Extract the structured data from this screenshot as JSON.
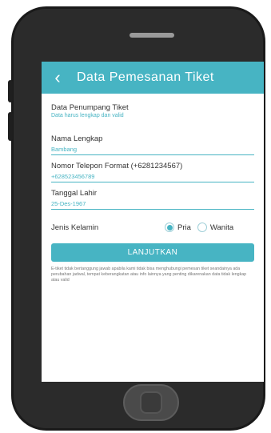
{
  "appbar": {
    "back_icon": "‹",
    "title": "Data Pemesanan Tiket"
  },
  "section": {
    "title": "Data Penumpang Tiket",
    "subtitle": "Data harus lengkap dan valid"
  },
  "fields": {
    "name": {
      "label": "Nama Lengkap",
      "value": "Bambang"
    },
    "phone": {
      "label": "Nomor Telepon Format (+6281234567)",
      "value": "+628523456789"
    },
    "dob": {
      "label": "Tanggal Lahir",
      "value": "25-Des-1967"
    }
  },
  "gender": {
    "label": "Jenis Kelamin",
    "options": [
      "Pria",
      "Wanita"
    ],
    "selected": "Pria"
  },
  "button": {
    "label": "LANJUTKAN"
  },
  "disclaimer": "E-tiket tidak bertanggung jawab apabila kami tidak bisa menghubungi pemesan tiket seandainya ada perubahan jadwal, tempat keberangkatan atau info lainnya yang penting dikarenakan data tidak lengkap atau valid",
  "colors": {
    "accent": "#47b4c3",
    "phone_body": "#2b2b2b"
  }
}
